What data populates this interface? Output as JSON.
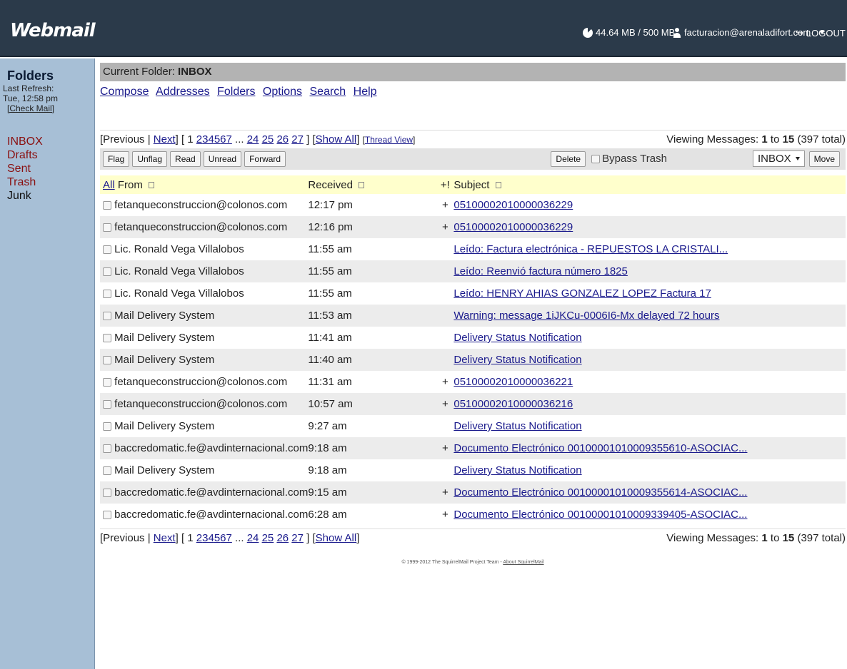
{
  "topbar": {
    "logo": "Webmail",
    "quota": "44.64 MB / 500 MB",
    "user": "facturacion@arenaladifort.com",
    "logout": "LOGOUT"
  },
  "sidebar": {
    "title": "Folders",
    "last_refresh_label": "Last Refresh:",
    "last_refresh_time": "Tue, 12:58 pm",
    "check_mail": "[Check Mail]",
    "folders": [
      "INBOX",
      "Drafts",
      "Sent",
      "Trash",
      "Junk"
    ]
  },
  "main": {
    "current_folder_label": "Current Folder:",
    "current_folder": "INBOX",
    "menu": [
      "Compose",
      "Addresses",
      "Folders",
      "Options",
      "Search",
      "Help"
    ],
    "pager": {
      "previous": "Previous",
      "next": "Next",
      "pages_current": "1",
      "pages_linked": [
        "2",
        "3",
        "4",
        "5",
        "6",
        "7"
      ],
      "ellipsis": "...",
      "pages_tail": [
        "24",
        "25",
        "26",
        "27"
      ],
      "show_all": "Show All",
      "thread_view": "Thread View",
      "viewing_label": "Viewing Messages:",
      "viewing_from": "1",
      "viewing_to": "to",
      "viewing_to_val": "15",
      "viewing_total": "(397 total)"
    },
    "toolbar": {
      "flag": "Flag",
      "unflag": "Unflag",
      "read": "Read",
      "unread": "Unread",
      "forward": "Forward",
      "delete": "Delete",
      "bypass_trash": "Bypass Trash",
      "move_folder": "INBOX",
      "move": "Move"
    },
    "table": {
      "all": "All",
      "from": "From",
      "received": "Received",
      "flags": "+!",
      "subject": "Subject",
      "rows": [
        {
          "from": "fetanqueconstruccion@colonos.com",
          "received": "12:17 pm",
          "flag": "+",
          "subject": "05100002010000036229"
        },
        {
          "from": "fetanqueconstruccion@colonos.com",
          "received": "12:16 pm",
          "flag": "+",
          "subject": "05100002010000036229"
        },
        {
          "from": "Lic. Ronald Vega Villalobos",
          "received": "11:55 am",
          "flag": "",
          "subject": "Leído: Factura electrónica - REPUESTOS LA CRISTALI..."
        },
        {
          "from": "Lic. Ronald Vega Villalobos",
          "received": "11:55 am",
          "flag": "",
          "subject": "Leído: Reenvió factura número 1825"
        },
        {
          "from": "Lic. Ronald Vega Villalobos",
          "received": "11:55 am",
          "flag": "",
          "subject": "Leído: HENRY AHIAS GONZALEZ LOPEZ Factura 17"
        },
        {
          "from": "Mail Delivery System",
          "received": "11:53 am",
          "flag": "",
          "subject": "Warning: message 1iJKCu-0006I6-Mx delayed 72 hours"
        },
        {
          "from": "Mail Delivery System",
          "received": "11:41 am",
          "flag": "",
          "subject": "Delivery Status Notification"
        },
        {
          "from": "Mail Delivery System",
          "received": "11:40 am",
          "flag": "",
          "subject": "Delivery Status Notification"
        },
        {
          "from": "fetanqueconstruccion@colonos.com",
          "received": "11:31 am",
          "flag": "+",
          "subject": "05100002010000036221"
        },
        {
          "from": "fetanqueconstruccion@colonos.com",
          "received": "10:57 am",
          "flag": "+",
          "subject": "05100002010000036216"
        },
        {
          "from": "Mail Delivery System",
          "received": "9:27 am",
          "flag": "",
          "subject": "Delivery Status Notification"
        },
        {
          "from": "baccredomatic.fe@avdinternacional.com",
          "received": "9:18 am",
          "flag": "+",
          "subject": "Documento Electrónico 00100001010009355610-ASOCIAC..."
        },
        {
          "from": "Mail Delivery System",
          "received": "9:18 am",
          "flag": "",
          "subject": "Delivery Status Notification"
        },
        {
          "from": "baccredomatic.fe@avdinternacional.com",
          "received": "9:15 am",
          "flag": "+",
          "subject": "Documento Electrónico 00100001010009355614-ASOCIAC..."
        },
        {
          "from": "baccredomatic.fe@avdinternacional.com",
          "received": "6:28 am",
          "flag": "+",
          "subject": "Documento Electrónico 00100001010009339405-ASOCIAC..."
        }
      ]
    },
    "footer": {
      "copyright": "© 1999-2012 The SquirrelMail Project Team -",
      "about": "About SquirrelMail"
    }
  }
}
